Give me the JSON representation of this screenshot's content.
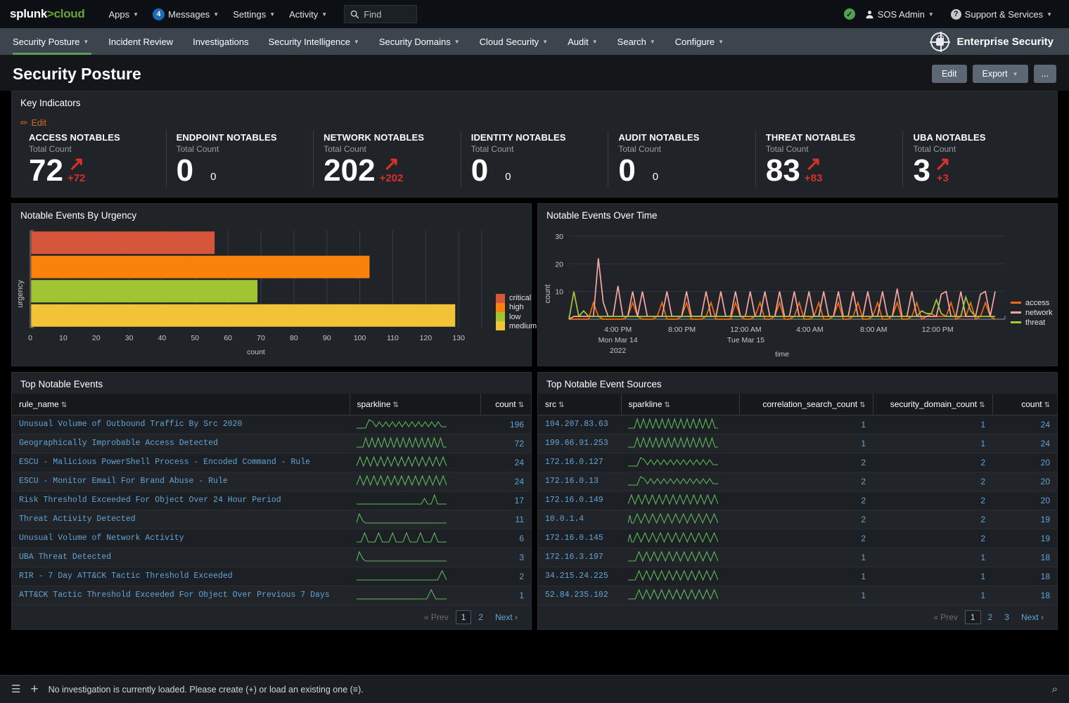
{
  "topbar": {
    "logo": {
      "part1": "splunk",
      "part2": ">",
      "part3": "cloud"
    },
    "apps": "Apps",
    "messages_count": "4",
    "messages": "Messages",
    "settings": "Settings",
    "activity": "Activity",
    "find_placeholder": "Find",
    "health_icon": "check-circle-icon",
    "user": "SOS Admin",
    "support": "Support & Services"
  },
  "nav": {
    "items": [
      {
        "label": "Security Posture",
        "has_caret": true,
        "active": true
      },
      {
        "label": "Incident Review",
        "has_caret": false,
        "active": false
      },
      {
        "label": "Investigations",
        "has_caret": false,
        "active": false
      },
      {
        "label": "Security Intelligence",
        "has_caret": true,
        "active": false
      },
      {
        "label": "Security Domains",
        "has_caret": true,
        "active": false
      },
      {
        "label": "Cloud Security",
        "has_caret": true,
        "active": false
      },
      {
        "label": "Audit",
        "has_caret": true,
        "active": false
      },
      {
        "label": "Search",
        "has_caret": true,
        "active": false
      },
      {
        "label": "Configure",
        "has_caret": true,
        "active": false
      }
    ],
    "app_title": "Enterprise Security"
  },
  "page": {
    "title": "Security Posture",
    "edit_button": "Edit",
    "export_button": "Export",
    "more_button": "..."
  },
  "key_indicators": {
    "panel_title": "Key Indicators",
    "edit_label": "Edit",
    "items": [
      {
        "name": "ACCESS NOTABLES",
        "sub": "Total Count",
        "value": "72",
        "delta": "+72",
        "trend": "up"
      },
      {
        "name": "ENDPOINT NOTABLES",
        "sub": "Total Count",
        "value": "0",
        "delta": "0",
        "trend": "flat"
      },
      {
        "name": "NETWORK NOTABLES",
        "sub": "Total Count",
        "value": "202",
        "delta": "+202",
        "trend": "up"
      },
      {
        "name": "IDENTITY NOTABLES",
        "sub": "Total Count",
        "value": "0",
        "delta": "0",
        "trend": "flat"
      },
      {
        "name": "AUDIT NOTABLES",
        "sub": "Total Count",
        "value": "0",
        "delta": "0",
        "trend": "flat"
      },
      {
        "name": "THREAT NOTABLES",
        "sub": "Total Count",
        "value": "83",
        "delta": "+83",
        "trend": "up"
      },
      {
        "name": "UBA NOTABLES",
        "sub": "Total Count",
        "value": "3",
        "delta": "+3",
        "trend": "up"
      }
    ]
  },
  "panels": {
    "urgency_title": "Notable Events By Urgency",
    "overtime_title": "Notable Events Over Time",
    "top_events_title": "Top Notable Events",
    "top_sources_title": "Top Notable Event Sources"
  },
  "chart_data": [
    {
      "type": "bar",
      "title": "Notable Events By Urgency",
      "orientation": "horizontal",
      "categories": [
        "critical",
        "high",
        "low",
        "medium"
      ],
      "values": [
        56,
        103,
        69,
        129
      ],
      "colors": [
        "#d6563c",
        "#f8820a",
        "#a1c434",
        "#f2c336"
      ],
      "xlabel": "count",
      "ylabel": "urgency",
      "xlim": [
        0,
        137
      ],
      "xticks": [
        0,
        10,
        20,
        30,
        40,
        50,
        60,
        70,
        80,
        90,
        100,
        110,
        120,
        130
      ],
      "grid": true,
      "legend": [
        "critical",
        "high",
        "low",
        "medium"
      ],
      "legend_position": "right"
    },
    {
      "type": "line",
      "title": "Notable Events Over Time",
      "xlabel": "time",
      "ylabel": "count",
      "ylim": [
        0,
        32
      ],
      "yticks": [
        10,
        20,
        30
      ],
      "grid": true,
      "legend_position": "right",
      "xticks": [
        "4:00 PM",
        "8:00 PM",
        "12:00 AM",
        "4:00 AM",
        "8:00 AM",
        "12:00 PM"
      ],
      "xtick_sublabels": [
        "Mon Mar 14",
        "",
        "Tue Mar 15",
        "",
        "",
        ""
      ],
      "xtick_year": "2022",
      "series": [
        {
          "name": "access",
          "color": "#f2690d",
          "values": [
            0,
            0,
            0,
            0,
            0,
            6,
            1,
            0,
            0,
            0,
            0,
            0,
            1,
            6,
            1,
            0,
            0,
            0,
            1,
            6,
            0,
            0,
            0,
            1,
            6,
            0,
            0,
            0,
            1,
            6,
            0,
            0,
            0,
            0,
            6,
            1,
            0,
            0,
            1,
            6,
            0,
            0,
            1,
            6,
            0,
            0,
            1,
            6,
            0,
            0,
            1,
            6,
            0,
            0,
            1,
            6,
            0,
            0,
            1,
            6,
            0,
            0,
            1,
            6,
            0,
            0,
            1,
            6,
            0,
            0,
            1,
            6,
            0,
            1,
            2,
            1,
            1,
            1,
            6,
            0,
            1,
            1,
            6,
            0,
            1,
            6,
            1,
            0
          ]
        },
        {
          "name": "network",
          "color": "#f7a7a0",
          "values": [
            0,
            1,
            1,
            1,
            1,
            1,
            22,
            6,
            1,
            1,
            12,
            1,
            1,
            10,
            1,
            10,
            1,
            1,
            1,
            1,
            10,
            1,
            1,
            1,
            10,
            1,
            1,
            1,
            10,
            1,
            1,
            10,
            1,
            1,
            10,
            1,
            1,
            10,
            1,
            1,
            10,
            1,
            1,
            10,
            1,
            1,
            10,
            1,
            1,
            10,
            1,
            1,
            10,
            1,
            1,
            10,
            1,
            1,
            10,
            1,
            1,
            10,
            1,
            1,
            10,
            1,
            1,
            11,
            1,
            1,
            10,
            1,
            1,
            1,
            1,
            1,
            9,
            10,
            1,
            1,
            10,
            1,
            1,
            1,
            9,
            10,
            1,
            10
          ]
        },
        {
          "name": "threat",
          "color": "#a5c83e",
          "values": [
            0,
            10,
            1,
            3,
            1,
            1,
            1,
            1,
            1,
            1,
            1,
            1,
            1,
            1,
            1,
            1,
            1,
            1,
            1,
            1,
            1,
            1,
            1,
            1,
            1,
            1,
            1,
            1,
            1,
            1,
            1,
            1,
            1,
            1,
            1,
            1,
            1,
            1,
            1,
            1,
            1,
            1,
            1,
            1,
            1,
            1,
            1,
            1,
            1,
            1,
            1,
            1,
            1,
            1,
            1,
            1,
            1,
            1,
            1,
            1,
            1,
            1,
            1,
            1,
            1,
            1,
            1,
            1,
            1,
            1,
            1,
            1,
            3,
            2,
            2,
            7,
            2,
            1,
            1,
            1,
            1,
            8,
            3,
            1,
            1,
            1,
            1,
            1
          ]
        }
      ]
    }
  ],
  "top_events": {
    "columns": [
      "rule_name",
      "sparkline",
      "count"
    ],
    "rows": [
      {
        "rule_name": "Unusual Volume of Outbound Traffic By Src 2020",
        "count": "196",
        "spark": "lowrise"
      },
      {
        "rule_name": "Geographically Improbable Access Detected",
        "count": "72",
        "spark": "peaks"
      },
      {
        "rule_name": "ESCU - Malicious PowerShell Process - Encoded Command - Rule",
        "count": "24",
        "spark": "dense"
      },
      {
        "rule_name": "ESCU - Monitor Email For Brand Abuse - Rule",
        "count": "24",
        "spark": "dense"
      },
      {
        "rule_name": "Risk Threshold Exceeded For Object Over 24 Hour Period",
        "count": "17",
        "spark": "flatend"
      },
      {
        "rule_name": "Threat Activity Detected",
        "count": "11",
        "spark": "startspike"
      },
      {
        "rule_name": "Unusual Volume of Network Activity",
        "count": "6",
        "spark": "sixspikes"
      },
      {
        "rule_name": "UBA Threat Detected",
        "count": "3",
        "spark": "startspike"
      },
      {
        "rule_name": "RIR - 7 Day ATT&CK Tactic Threshold Exceeded",
        "count": "2",
        "spark": "endspike"
      },
      {
        "rule_name": "ATT&CK Tactic Threshold Exceeded For Object Over Previous 7 Days",
        "count": "1",
        "spark": "nearendspike"
      }
    ],
    "pager": {
      "prev": "« Prev",
      "pages": [
        "1",
        "2"
      ],
      "current": "1",
      "next": "Next ›"
    }
  },
  "top_sources": {
    "columns": [
      "src",
      "sparkline",
      "correlation_search_count",
      "security_domain_count",
      "count"
    ],
    "rows": [
      {
        "src": "104.207.83.63",
        "correlation_search_count": "1",
        "security_domain_count": "1",
        "count": "24",
        "spark": "peaks"
      },
      {
        "src": "199.66.91.253",
        "correlation_search_count": "1",
        "security_domain_count": "1",
        "count": "24",
        "spark": "peaks"
      },
      {
        "src": "172.16.0.127",
        "correlation_search_count": "2",
        "security_domain_count": "2",
        "count": "20",
        "spark": "lowrise"
      },
      {
        "src": "172.16.0.13",
        "correlation_search_count": "2",
        "security_domain_count": "2",
        "count": "20",
        "spark": "lowrise"
      },
      {
        "src": "172.16.0.149",
        "correlation_search_count": "2",
        "security_domain_count": "2",
        "count": "20",
        "spark": "dense"
      },
      {
        "src": "10.0.1.4",
        "correlation_search_count": "2",
        "security_domain_count": "2",
        "count": "19",
        "spark": "dense2"
      },
      {
        "src": "172.16.0.145",
        "correlation_search_count": "2",
        "security_domain_count": "2",
        "count": "19",
        "spark": "dense2"
      },
      {
        "src": "172.16.3.197",
        "correlation_search_count": "1",
        "security_domain_count": "1",
        "count": "18",
        "spark": "dense3"
      },
      {
        "src": "34.215.24.225",
        "correlation_search_count": "1",
        "security_domain_count": "1",
        "count": "18",
        "spark": "dense3"
      },
      {
        "src": "52.84.235.102",
        "correlation_search_count": "1",
        "security_domain_count": "1",
        "count": "18",
        "spark": "dense3"
      }
    ],
    "pager": {
      "prev": "« Prev",
      "pages": [
        "1",
        "2",
        "3"
      ],
      "current": "1",
      "next": "Next ›"
    }
  },
  "footer": {
    "text": "No investigation is currently loaded. Please create (+) or load an existing one (≡).",
    "list_icon": "list-icon",
    "plus_icon": "plus-icon",
    "search_icon": "magnifier-icon"
  }
}
